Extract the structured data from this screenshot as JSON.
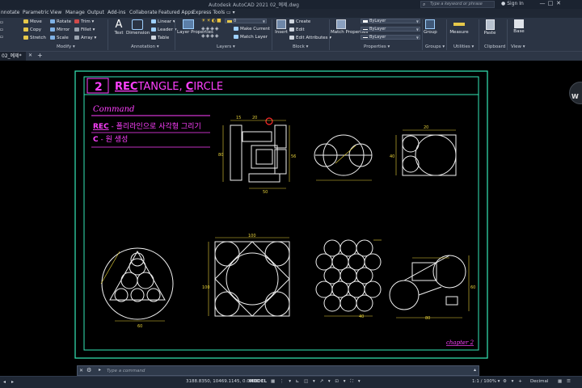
{
  "app": {
    "title": "Autodesk AutoCAD 2021    02_예제.dwg",
    "search_placeholder": "Type a keyword or phrase",
    "signin": "Sign In",
    "window_controls": [
      "—",
      "□",
      "✕"
    ]
  },
  "ribbon_tabs": [
    "nnotate",
    "Parametric",
    "View",
    "Manage",
    "Output",
    "Add-ins",
    "Collaborate",
    "Featured Apps",
    "Express Tools",
    "▭ ▾"
  ],
  "ribbon": {
    "modify": {
      "title": "Modify ▾",
      "buttons": [
        "Move",
        "Rotate",
        "Trim ▾",
        "Copy",
        "Mirror",
        "Fillet ▾",
        "Stretch",
        "Scale",
        "Array ▾"
      ]
    },
    "annotation": {
      "title": "Annotation ▾",
      "big": [
        "Text",
        "Dimension"
      ],
      "small": [
        "Linear ▾",
        "Leader ▾",
        "Table"
      ]
    },
    "layers": {
      "title": "Layers ▾",
      "big": "Layer Properties",
      "combo": "0",
      "small": [
        "Make Current",
        "Match Layer"
      ]
    },
    "block": {
      "title": "Block ▾",
      "big": "Insert",
      "small": [
        "Create",
        "Edit",
        "Edit Attributes ▾"
      ]
    },
    "properties": {
      "title": "Properties ▾",
      "big": "Match Properties",
      "combos": [
        "ByLayer",
        "ByLayer",
        "ByLayer"
      ]
    },
    "groups": {
      "title": "Groups ▾",
      "big": "Group"
    },
    "utilities": {
      "title": "Utilities ▾",
      "big": "Measure"
    },
    "clipboard": {
      "title": "Clipboard",
      "big": "Paste"
    },
    "view": {
      "title": "View ▾",
      "big": "Base"
    }
  },
  "document": {
    "tab_label": "02_예제*",
    "close_glyph": "✕",
    "add_glyph": "+"
  },
  "drawing": {
    "number": "2",
    "title_parts": [
      "REC",
      "TANGLE, ",
      "C",
      "IRCLE"
    ],
    "command_heading": "Command",
    "commands": [
      {
        "key": "REC",
        "desc": " - 폴리라인으로 사각형 그리기"
      },
      {
        "key": "C",
        "desc": " - 원 생성"
      }
    ],
    "chapter": "chapter 2",
    "dims": {
      "d1": "15",
      "d2": "20",
      "d3": "80",
      "d4": "50",
      "d5": "56",
      "d6": "20",
      "d7": "40",
      "d8": "60",
      "d9": "100",
      "d10": "100",
      "d11": "80",
      "d12": "60",
      "d13": "40"
    },
    "colors": {
      "frame": "#35e8b8",
      "title": "#ff40ff",
      "lines": "#f0f0f0",
      "dims": "#e8d23a",
      "marker": "#ff2a2a"
    }
  },
  "viewcube_label": "W",
  "command_line": {
    "placeholder": "Type a command",
    "icons": [
      "close-icon",
      "wrench-icon",
      "chevron-right-icon"
    ]
  },
  "status": {
    "layout_tabs": [
      "◂",
      "▸"
    ],
    "coords": "3188.8350, 10469.1145, 0.0000",
    "model": "MODEL",
    "scale": "1:1 / 100% ▾",
    "units": "Decimal"
  }
}
